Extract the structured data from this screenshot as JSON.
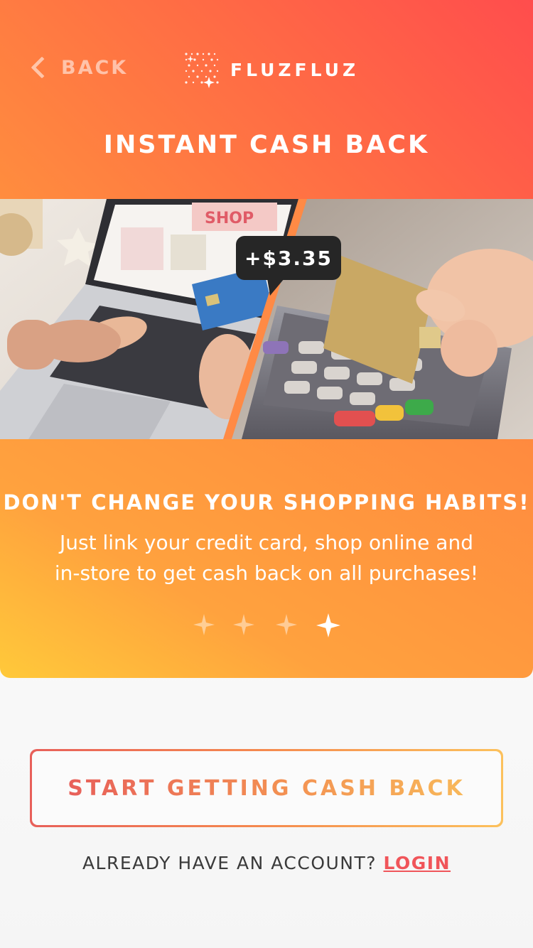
{
  "header": {
    "back_label": "BACK",
    "logo_text": "FLUZFLUZ",
    "title": "INSTANT CASH BACK"
  },
  "hero": {
    "cashback_badge": "+$3.35"
  },
  "card": {
    "heading": "DON'T CHANGE YOUR SHOPPING HABITS!",
    "body_line1": "Just link your credit card, shop online and",
    "body_line2": "in-store to get cash back on all purchases!",
    "page_indicator": {
      "total": 4,
      "active_index": 3
    }
  },
  "cta": {
    "label": "START GETTING CASH BACK"
  },
  "login": {
    "prompt": "ALREADY HAVE AN ACCOUNT?",
    "link_label": "LOGIN"
  },
  "colors": {
    "header_gradient": [
      "#ff4d4d",
      "#ff8d3e"
    ],
    "card_gradient": [
      "#ffc93a",
      "#ff8a3f"
    ],
    "accent": "#f0555a"
  },
  "icons": {
    "back": "chevron-left-icon",
    "logo": "fluzfluz-sparkle-grid-logo",
    "page_dot": "sparkle-star-icon"
  }
}
